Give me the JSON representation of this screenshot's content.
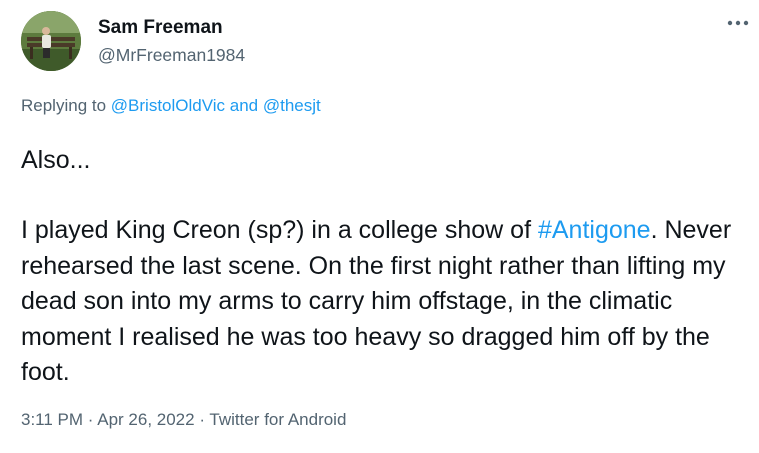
{
  "author": {
    "name": "Sam Freeman",
    "handle": "@MrFreeman1984"
  },
  "more_icon": "more-horizontal-icon",
  "reply": {
    "prefix": "Replying to ",
    "user1": "@BristolOldVic",
    "joiner": " and ",
    "user2": "@thesjt"
  },
  "tweet": {
    "line1": "Also...",
    "para_before": "I played King Creon (sp?) in a college show of ",
    "hashtag": "#Antigone",
    "para_after": ". Never rehearsed the last scene. On the first night rather than lifting my dead son into my arms to carry him offstage, in the climatic moment I realised he was too heavy so dragged him off by the foot."
  },
  "meta": {
    "time": "3:11 PM",
    "dot1": " · ",
    "date": "Apr 26, 2022",
    "dot2": " · ",
    "source": "Twitter for Android"
  },
  "colors": {
    "link": "#1d9bf0",
    "secondary_text": "#536471",
    "primary_text": "#0f1419"
  }
}
